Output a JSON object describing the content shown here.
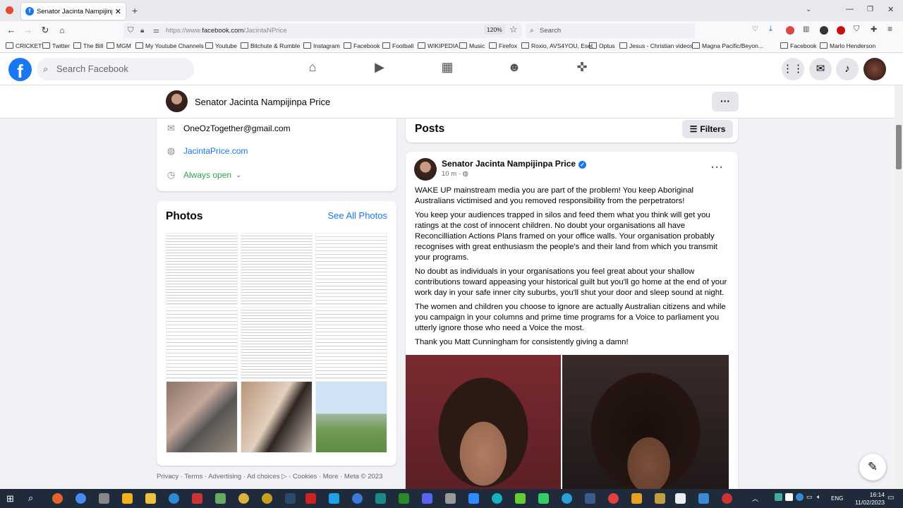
{
  "browser": {
    "tab_title": "Senator Jacinta Nampijinpa Pric",
    "url_prefix": "https://www.",
    "url_domain": "facebook.com",
    "url_path": "/JacintaNPrice",
    "zoom": "120%",
    "search_placeholder": "Search",
    "bookmarks": [
      "CRICKET",
      "Twitter",
      "The Bill",
      "MGM",
      "My Youtube Channels",
      "Youtube",
      "Bitchute & Rumble",
      "Instagram",
      "Facebook",
      "Football",
      "WIKIPEDIA",
      "Music",
      "Firefox",
      "Roxio, AVS4YOU, Eset",
      "Optus",
      "Jesus - Christian videos",
      "Magna Pacific/Beyon...",
      "Facebook",
      "Marlo Henderson"
    ]
  },
  "fb": {
    "search_placeholder": "Search Facebook"
  },
  "profile": {
    "name": "Senator Jacinta Nampijinpa Price",
    "email": "OneOzTogether@gmail.com",
    "website": "JacintaPrice.com",
    "hours": "Always open"
  },
  "photos": {
    "title": "Photos",
    "see_all": "See All Photos"
  },
  "footer": "Privacy · Terms · Advertising · Ad choices ▷ · Cookies · More · Meta © 2023",
  "posts": {
    "title": "Posts",
    "filters": "Filters"
  },
  "post": {
    "author": "Senator Jacinta Nampijinpa Price",
    "time": "10 m · ",
    "paragraphs": [
      "WAKE UP mainstream media you are part of the problem! You keep Aboriginal Australians victimised and you removed responsibility from the perpetrators!",
      "You keep your audiences trapped in silos and feed them what you think will get you ratings at the cost of innocent children. No doubt your organisations all have Reconcilliation Actions Plans framed on your office walls. Your organisation probably recognises with great enthusiasm the people's and their land from which you transmit your programs.",
      "No doubt as individuals in your organisations you feel great about your shallow contributions toward appeasing your historical guilt but you'll go home at the end of your work day in your safe inner city suburbs, you'll shut your door and sleep sound at night.",
      "The women and children you choose to ignore are actually Australian citizens and while you campaign in your columns and prime time programs for a Voice to parliament you utterly ignore those who need a Voice the most.",
      "Thank you Matt Cunningham for consistently giving a damn!"
    ]
  },
  "taskbar": {
    "lang": "ENG",
    "time": "16:14",
    "date": "11/02/2023"
  }
}
